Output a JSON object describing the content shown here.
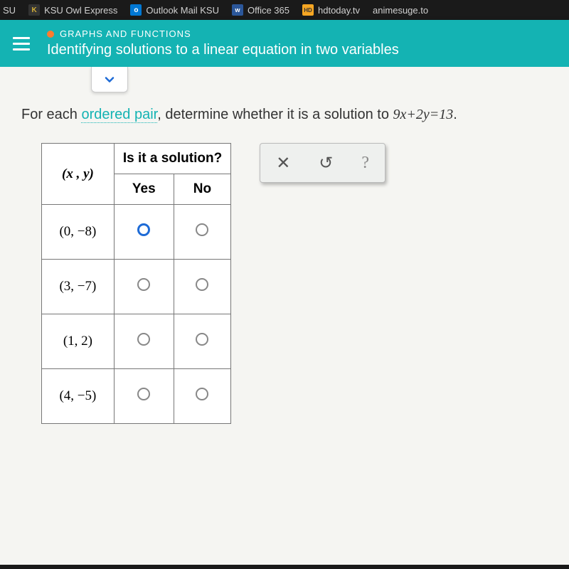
{
  "bookmarks": [
    {
      "label": "SU",
      "favicon": ""
    },
    {
      "label": "KSU Owl Express",
      "favicon": "ksu"
    },
    {
      "label": "Outlook Mail KSU",
      "favicon": "outlook"
    },
    {
      "label": "Office 365",
      "favicon": "office"
    },
    {
      "label": "hdtoday.tv",
      "favicon": "hd"
    },
    {
      "label": "animesuge.to",
      "favicon": ""
    }
  ],
  "header": {
    "section": "GRAPHS AND FUNCTIONS",
    "title": "Identifying solutions to a linear equation in two variables"
  },
  "question": {
    "prefix": "For each ",
    "linked_term": "ordered pair",
    "middle": ", determine whether it is a solution to ",
    "equation": "9x + 2y = 13",
    "suffix": "."
  },
  "table": {
    "header_main": "Is it a solution?",
    "header_xy": "(x , y)",
    "header_yes": "Yes",
    "header_no": "No",
    "rows": [
      {
        "pair": "(0, −8)",
        "selected": "yes"
      },
      {
        "pair": "(3, −7)",
        "selected": ""
      },
      {
        "pair": "(1, 2)",
        "selected": ""
      },
      {
        "pair": "(4, −5)",
        "selected": ""
      }
    ]
  },
  "tools": {
    "close": "✕",
    "reset": "↺",
    "help": "?"
  }
}
